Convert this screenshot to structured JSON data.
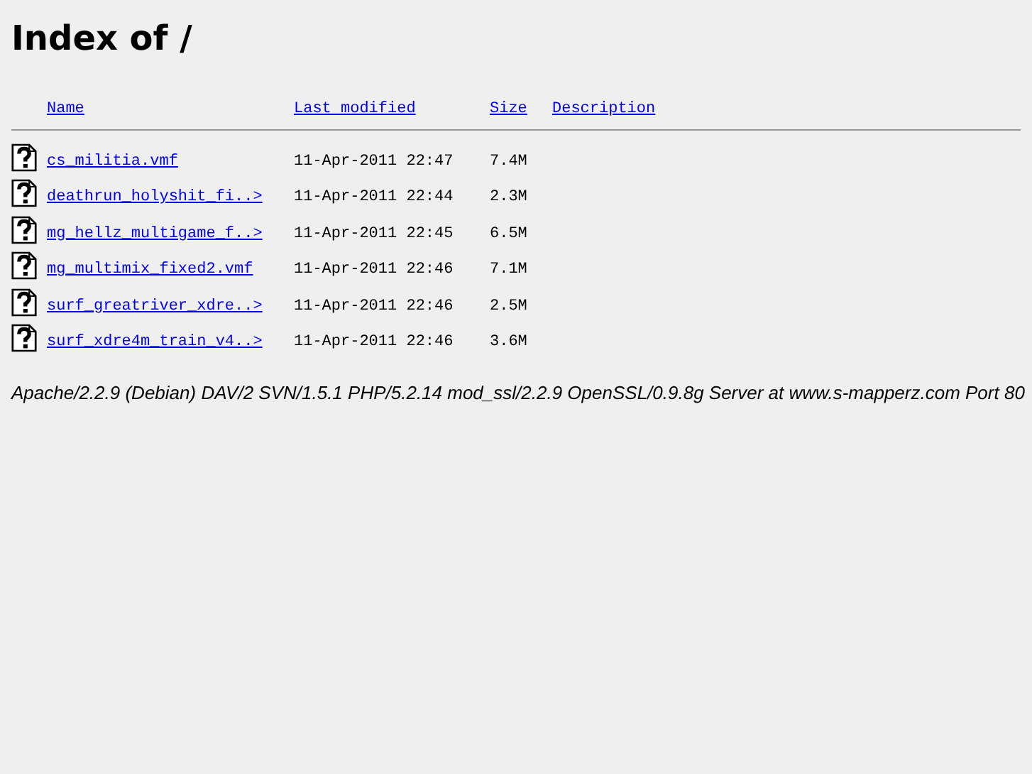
{
  "title": "Index of /",
  "columns": [
    "Name",
    "Last modified",
    "Size",
    "Description"
  ],
  "rows": [
    {
      "name": "cs_militia.vmf",
      "modified": "11-Apr-2011 22:47",
      "size": "7.4M"
    },
    {
      "name": "deathrun_holyshit_fi..>",
      "modified": "11-Apr-2011 22:44",
      "size": "2.3M"
    },
    {
      "name": "mg_hellz_multigame_f..>",
      "modified": "11-Apr-2011 22:45",
      "size": "6.5M"
    },
    {
      "name": "mg_multimix_fixed2.vmf",
      "modified": "11-Apr-2011 22:46",
      "size": "7.1M"
    },
    {
      "name": "surf_greatriver_xdre..>",
      "modified": "11-Apr-2011 22:46",
      "size": "2.5M"
    },
    {
      "name": "surf_xdre4m_train_v4..>",
      "modified": "11-Apr-2011 22:46",
      "size": "3.6M"
    }
  ],
  "footer": "Apache/2.2.9 (Debian) DAV/2 SVN/1.5.1 PHP/5.2.14 mod_ssl/2.2.9 OpenSSL/0.9.8g Server at www.s-mapperz.com Port 80"
}
